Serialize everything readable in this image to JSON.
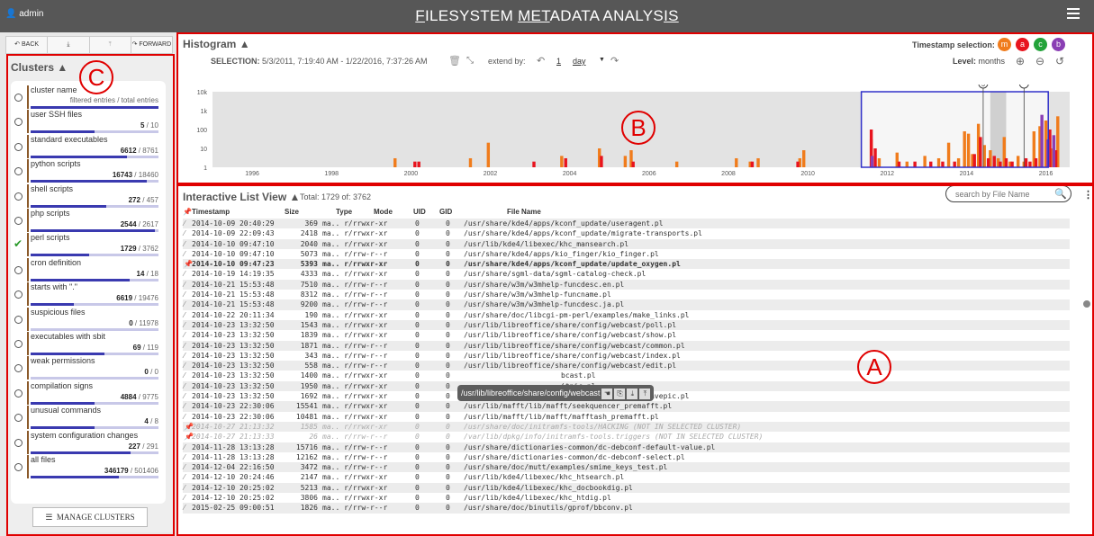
{
  "topbar": {
    "user": "admin",
    "title": "FILESYSTEM METADATA ANALYSIS"
  },
  "toolbar": {
    "back": "BACK",
    "forward": "FORWARD"
  },
  "clusters": {
    "title": "Clusters",
    "header_sub": "filtered entries / total entries",
    "items": [
      {
        "name": "cluster name",
        "filtered": "",
        "total": "",
        "fraction": 1.0,
        "checked": false
      },
      {
        "name": "user SSH files",
        "filtered": "5",
        "total": "10",
        "fraction": 0.5,
        "checked": false
      },
      {
        "name": "standard executables",
        "filtered": "6612",
        "total": "8761",
        "fraction": 0.755,
        "checked": false
      },
      {
        "name": "python scripts",
        "filtered": "16743",
        "total": "18460",
        "fraction": 0.907,
        "checked": false
      },
      {
        "name": "shell scripts",
        "filtered": "272",
        "total": "457",
        "fraction": 0.595,
        "checked": false
      },
      {
        "name": "php scripts",
        "filtered": "2544",
        "total": "2617",
        "fraction": 0.972,
        "checked": false
      },
      {
        "name": "perl scripts",
        "filtered": "1729",
        "total": "3762",
        "fraction": 0.46,
        "checked": true
      },
      {
        "name": "cron definition",
        "filtered": "14",
        "total": "18",
        "fraction": 0.778,
        "checked": false
      },
      {
        "name": "starts with \".\"",
        "filtered": "6619",
        "total": "19476",
        "fraction": 0.34,
        "checked": false
      },
      {
        "name": "suspicious files",
        "filtered": "0",
        "total": "11978",
        "fraction": 0.0,
        "checked": false
      },
      {
        "name": "executables with sbit",
        "filtered": "69",
        "total": "119",
        "fraction": 0.58,
        "checked": false
      },
      {
        "name": "weak permissions",
        "filtered": "0",
        "total": "0",
        "fraction": 0.0,
        "checked": false
      },
      {
        "name": "compilation signs",
        "filtered": "4884",
        "total": "9775",
        "fraction": 0.5,
        "checked": false
      },
      {
        "name": "unusual commands",
        "filtered": "4",
        "total": "8",
        "fraction": 0.5,
        "checked": false
      },
      {
        "name": "system configuration changes",
        "filtered": "227",
        "total": "291",
        "fraction": 0.78,
        "checked": false
      },
      {
        "name": "all files",
        "filtered": "346179",
        "total": "501406",
        "fraction": 0.69,
        "checked": false
      }
    ],
    "manage_label": "MANAGE CLUSTERS"
  },
  "annotations": {
    "a": "A",
    "b": "B",
    "c": "C"
  },
  "histogram": {
    "title": "Histogram",
    "selection_label": "SELECTION:",
    "selection_value": "5/3/2011, 7:19:40 AM - 1/22/2016, 7:37:26 AM",
    "extend_label": "extend by:",
    "extend_num": "1",
    "extend_unit": "day",
    "ts_label": "Timestamp selection:",
    "ts_buttons": [
      {
        "label": "m",
        "color": "#f07c1c"
      },
      {
        "label": "a",
        "color": "#e8141e"
      },
      {
        "label": "c",
        "color": "#23a33a"
      },
      {
        "label": "b",
        "color": "#8a3fb4"
      }
    ],
    "level_label": "Level:",
    "level_value": "months",
    "marker_label": "3"
  },
  "chart_data": {
    "type": "bar",
    "title": "",
    "yscale": "log",
    "yticks": [
      "10k",
      "1k",
      "100",
      "10",
      "1"
    ],
    "xticks": [
      "1996",
      "1998",
      "2000",
      "2002",
      "2004",
      "2006",
      "2008",
      "2010",
      "2012",
      "2014",
      "2016"
    ],
    "series": [
      {
        "name": "m",
        "color": "#f07c1c",
        "x": [
          1999.6,
          2001.5,
          2001.95,
          2003.8,
          2004.75,
          2005.4,
          2005.55,
          2006.7,
          2008.2,
          2008.55,
          2008.75,
          2009.8,
          2009.9,
          2011.6,
          2011.8,
          2012.25,
          2012.5,
          2012.95,
          2013.3,
          2013.55,
          2013.8,
          2013.95,
          2014.05,
          2014.15,
          2014.3,
          2014.45,
          2014.6,
          2014.8,
          2014.95,
          2015.1,
          2015.3,
          2015.45,
          2015.7,
          2015.85,
          2016.0,
          2016.15,
          2016.3
        ],
        "values": [
          3,
          3,
          20,
          4,
          10,
          4,
          8,
          2,
          3,
          2,
          3,
          3,
          8,
          30,
          3,
          6,
          2,
          4,
          3,
          20,
          3,
          80,
          60,
          5,
          200,
          15,
          8,
          3,
          40,
          2,
          4,
          2,
          80,
          150,
          300,
          10,
          500
        ]
      },
      {
        "name": "a",
        "color": "#e8141e",
        "x": [
          2000.1,
          2000.2,
          2003.1,
          2003.9,
          2004.8,
          2005.6,
          2008.6,
          2009.75,
          2011.6,
          2011.7,
          2012.3,
          2012.7,
          2013.1,
          2013.4,
          2013.7,
          2014.2,
          2014.35,
          2014.55,
          2014.7,
          2014.85,
          2015.0,
          2015.15,
          2015.5,
          2015.6,
          2015.75,
          2016.1,
          2016.25
        ],
        "values": [
          2,
          2,
          2,
          3,
          4,
          2,
          2,
          2,
          100,
          10,
          2,
          2,
          2,
          2,
          2,
          5,
          40,
          3,
          4,
          2,
          3,
          2,
          3,
          2,
          3,
          100,
          8
        ]
      },
      {
        "name": "b",
        "color": "#8a3fb4",
        "x": [
          2011.62,
          2015.9,
          2016.05,
          2016.2
        ],
        "values": [
          4,
          600,
          30,
          50
        ]
      }
    ]
  },
  "list": {
    "title": "Interactive List View",
    "total": "Total: 1729 of: 3762",
    "search_placeholder": "search by File Name",
    "headers": {
      "timestamp": "Timestamp",
      "size": "Size",
      "type": "Type",
      "mode": "Mode",
      "uid": "UID",
      "gid": "GID",
      "filename": "File Name"
    },
    "rows": [
      {
        "ts": "2014-10-09 20:40:29",
        "size": "369",
        "type": "ma..",
        "mode": "r/rrwxr-xr",
        "uid": "0",
        "gid": "0",
        "fn": "/usr/share/kde4/apps/kconf_update/useragent.pl",
        "style": ""
      },
      {
        "ts": "2014-10-09 22:09:43",
        "size": "2418",
        "type": "ma..",
        "mode": "r/rrwxr-xr",
        "uid": "0",
        "gid": "0",
        "fn": "/usr/share/kde4/apps/kconf_update/migrate-transports.pl",
        "style": ""
      },
      {
        "ts": "2014-10-10 09:47:10",
        "size": "2040",
        "type": "ma..",
        "mode": "r/rrwxr-xr",
        "uid": "0",
        "gid": "0",
        "fn": "/usr/lib/kde4/libexec/khc_mansearch.pl",
        "style": ""
      },
      {
        "ts": "2014-10-10 09:47:10",
        "size": "5073",
        "type": "ma..",
        "mode": "r/rrw-r--r",
        "uid": "0",
        "gid": "0",
        "fn": "/usr/share/kde4/apps/kio_finger/kio_finger.pl",
        "style": ""
      },
      {
        "ts": "2014-10-10 09:47:23",
        "size": "5393",
        "type": "ma..",
        "mode": "r/rrwxr-xr",
        "uid": "0",
        "gid": "0",
        "fn": "/usr/share/kde4/apps/kconf_update/update_oxygen.pl",
        "style": "bold"
      },
      {
        "ts": "2014-10-19 14:19:35",
        "size": "4333",
        "type": "ma..",
        "mode": "r/rrwxr-xr",
        "uid": "0",
        "gid": "0",
        "fn": "/usr/share/sgml-data/sgml-catalog-check.pl",
        "style": ""
      },
      {
        "ts": "2014-10-21 15:53:48",
        "size": "7510",
        "type": "ma..",
        "mode": "r/rrw-r--r",
        "uid": "0",
        "gid": "0",
        "fn": "/usr/share/w3m/w3mhelp-funcdesc.en.pl",
        "style": ""
      },
      {
        "ts": "2014-10-21 15:53:48",
        "size": "8312",
        "type": "ma..",
        "mode": "r/rrw-r--r",
        "uid": "0",
        "gid": "0",
        "fn": "/usr/share/w3m/w3mhelp-funcname.pl",
        "style": ""
      },
      {
        "ts": "2014-10-21 15:53:48",
        "size": "9200",
        "type": "ma..",
        "mode": "r/rrw-r--r",
        "uid": "0",
        "gid": "0",
        "fn": "/usr/share/w3m/w3mhelp-funcdesc.ja.pl",
        "style": ""
      },
      {
        "ts": "2014-10-22 20:11:34",
        "size": "190",
        "type": "ma..",
        "mode": "r/rrwxr-xr",
        "uid": "0",
        "gid": "0",
        "fn": "/usr/share/doc/libcgi-pm-perl/examples/make_links.pl",
        "style": ""
      },
      {
        "ts": "2014-10-23 13:32:50",
        "size": "1543",
        "type": "ma..",
        "mode": "r/rrwxr-xr",
        "uid": "0",
        "gid": "0",
        "fn": "/usr/lib/libreoffice/share/config/webcast/poll.pl",
        "style": ""
      },
      {
        "ts": "2014-10-23 13:32:50",
        "size": "1839",
        "type": "ma..",
        "mode": "r/rrwxr-xr",
        "uid": "0",
        "gid": "0",
        "fn": "/usr/lib/libreoffice/share/config/webcast/show.pl",
        "style": ""
      },
      {
        "ts": "2014-10-23 13:32:50",
        "size": "1871",
        "type": "ma..",
        "mode": "r/rrw-r--r",
        "uid": "0",
        "gid": "0",
        "fn": "/usr/lib/libreoffice/share/config/webcast/common.pl",
        "style": ""
      },
      {
        "ts": "2014-10-23 13:32:50",
        "size": "343",
        "type": "ma..",
        "mode": "r/rrw-r--r",
        "uid": "0",
        "gid": "0",
        "fn": "/usr/lib/libreoffice/share/config/webcast/index.pl",
        "style": ""
      },
      {
        "ts": "2014-10-23 13:32:50",
        "size": "558",
        "type": "ma..",
        "mode": "r/rrw-r--r",
        "uid": "0",
        "gid": "0",
        "fn": "/usr/lib/libreoffice/share/config/webcast/edit.pl",
        "style": ""
      },
      {
        "ts": "2014-10-23 13:32:50",
        "size": "1400",
        "type": "ma..",
        "mode": "r/rrwxr-xr",
        "uid": "0",
        "gid": "0",
        "fn": "",
        "tail": "bcast.pl",
        "style": ""
      },
      {
        "ts": "2014-10-23 13:32:50",
        "size": "1950",
        "type": "ma..",
        "mode": "r/rrwxr-xr",
        "uid": "0",
        "gid": "0",
        "fn": "",
        "tail": "itpic.pl",
        "style": ""
      },
      {
        "ts": "2014-10-23 13:32:50",
        "size": "1692",
        "type": "ma..",
        "mode": "r/rrwxr-xr",
        "uid": "0",
        "gid": "0",
        "fn": "/usr/lib/libreoffice/share/config/webcast/",
        "tail": "savepic.pl",
        "style": "hl"
      },
      {
        "ts": "2014-10-23 22:30:06",
        "size": "15541",
        "type": "ma..",
        "mode": "r/rrwxr-xr",
        "uid": "0",
        "gid": "0",
        "fn": "/usr/lib/mafft/lib/mafft/seekquencer_premafft.pl",
        "style": ""
      },
      {
        "ts": "2014-10-23 22:30:06",
        "size": "10481",
        "type": "ma..",
        "mode": "r/rrwxr-xr",
        "uid": "0",
        "gid": "0",
        "fn": "/usr/lib/mafft/lib/mafft/mafftash_premafft.pl",
        "style": ""
      },
      {
        "ts": "2014-10-27 21:13:32",
        "size": "1585",
        "type": "ma..",
        "mode": "r/rrwxr-xr",
        "uid": "0",
        "gid": "0",
        "fn": "/usr/share/doc/initramfs-tools/HACKING (NOT IN SELECTED CLUSTER)",
        "style": "dim"
      },
      {
        "ts": "2014-10-27 21:13:33",
        "size": "26",
        "type": "ma..",
        "mode": "r/rrw-r--r",
        "uid": "0",
        "gid": "0",
        "fn": "/var/lib/dpkg/info/initramfs-tools.triggers (NOT IN SELECTED CLUSTER)",
        "style": "dim"
      },
      {
        "ts": "2014-11-28 13:13:28",
        "size": "15716",
        "type": "ma..",
        "mode": "r/rrw-r--r",
        "uid": "0",
        "gid": "0",
        "fn": "/usr/share/dictionaries-common/dc-debconf-default-value.pl",
        "style": ""
      },
      {
        "ts": "2014-11-28 13:13:28",
        "size": "12162",
        "type": "ma..",
        "mode": "r/rrw-r--r",
        "uid": "0",
        "gid": "0",
        "fn": "/usr/share/dictionaries-common/dc-debconf-select.pl",
        "style": ""
      },
      {
        "ts": "2014-12-04 22:16:50",
        "size": "3472",
        "type": "ma..",
        "mode": "r/rrw-r--r",
        "uid": "0",
        "gid": "0",
        "fn": "/usr/share/doc/mutt/examples/smime_keys_test.pl",
        "style": ""
      },
      {
        "ts": "2014-12-10 20:24:46",
        "size": "2147",
        "type": "ma..",
        "mode": "r/rrwxr-xr",
        "uid": "0",
        "gid": "0",
        "fn": "/usr/lib/kde4/libexec/khc_htsearch.pl",
        "style": ""
      },
      {
        "ts": "2014-12-10 20:25:02",
        "size": "5213",
        "type": "ma..",
        "mode": "r/rrwxr-xr",
        "uid": "0",
        "gid": "0",
        "fn": "/usr/lib/kde4/libexec/khc_docbookdig.pl",
        "style": ""
      },
      {
        "ts": "2014-12-10 20:25:02",
        "size": "3806",
        "type": "ma..",
        "mode": "r/rrwxr-xr",
        "uid": "0",
        "gid": "0",
        "fn": "/usr/lib/kde4/libexec/khc_htdig.pl",
        "style": ""
      },
      {
        "ts": "2015-02-25 09:00:51",
        "size": "1826",
        "type": "ma..",
        "mode": "r/rrw-r--r",
        "uid": "0",
        "gid": "0",
        "fn": "/usr/share/doc/binutils/gprof/bbconv.pl",
        "style": ""
      }
    ],
    "tooltip": "/usr/lib/libreoffice/share/config/webcast"
  }
}
